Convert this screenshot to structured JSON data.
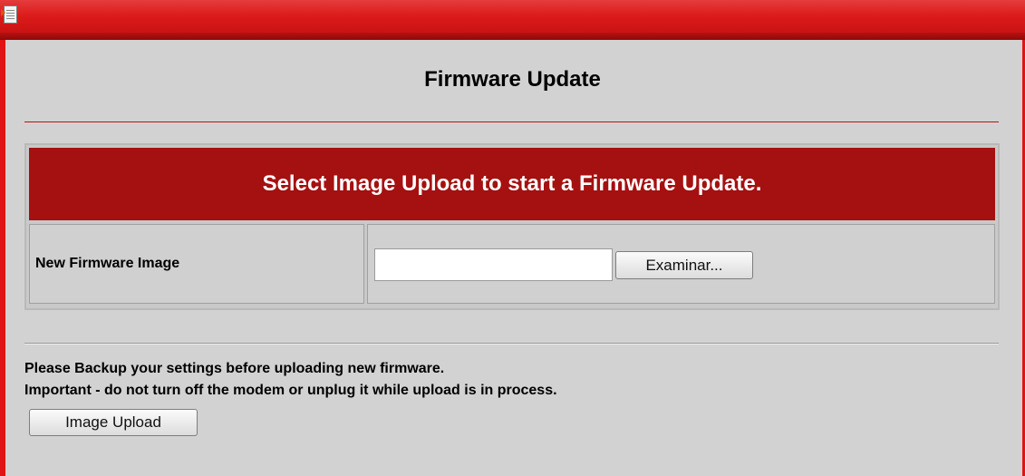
{
  "page": {
    "title": "Firmware Update"
  },
  "banner": {
    "text": "Select Image Upload to start a Firmware Update."
  },
  "form": {
    "label": "New Firmware Image",
    "file_value": "",
    "browse_label": "Examinar..."
  },
  "notes": {
    "line1": "Please Backup your settings before uploading new firmware.",
    "line2": "Important - do not turn off the modem or unplug it while upload is in process."
  },
  "actions": {
    "upload_label": "Image Upload"
  },
  "colors": {
    "accent_red": "#a51010",
    "frame_red": "#e01414",
    "background": "#d2d2d2"
  },
  "icons": {
    "corner": "document-icon"
  }
}
